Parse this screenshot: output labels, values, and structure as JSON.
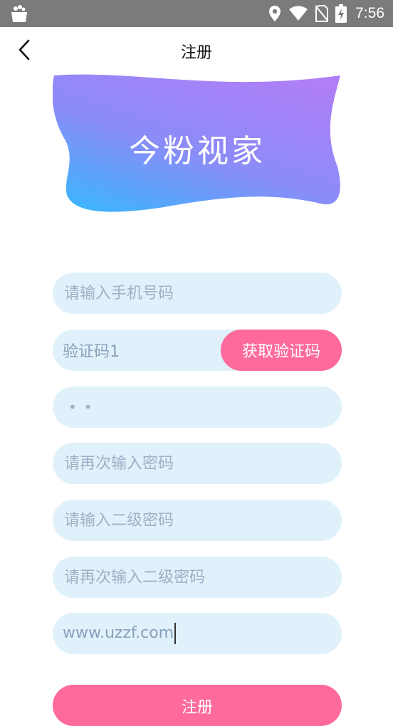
{
  "status_bar": {
    "time": "7:56",
    "icons": [
      "shopping-bag-icon",
      "location-icon",
      "wifi-icon",
      "no-sim-icon",
      "battery-charging-icon"
    ]
  },
  "header": {
    "title": "注册",
    "back_icon": "chevron-left-icon"
  },
  "banner": {
    "title": "今粉视家",
    "gradient_colors": [
      "#b07ef7",
      "#3fb3fd"
    ]
  },
  "form": {
    "phone": {
      "placeholder": "请输入手机号码",
      "value": ""
    },
    "code": {
      "value": "验证码1",
      "button_label": "获取验证码"
    },
    "password": {
      "masked": "••"
    },
    "password_confirm": {
      "placeholder": "请再次输入密码",
      "value": ""
    },
    "secondary_password": {
      "placeholder": "请输入二级密码",
      "value": ""
    },
    "secondary_password_confirm": {
      "placeholder": "请再次输入二级密码",
      "value": ""
    },
    "invite": {
      "value": "www.uzzf.com"
    }
  },
  "register_button": {
    "label": "注册"
  },
  "colors": {
    "accent": "#fe6a9c",
    "field_bg": "#e0f1fb",
    "status_bar": "#7b7b7b"
  }
}
